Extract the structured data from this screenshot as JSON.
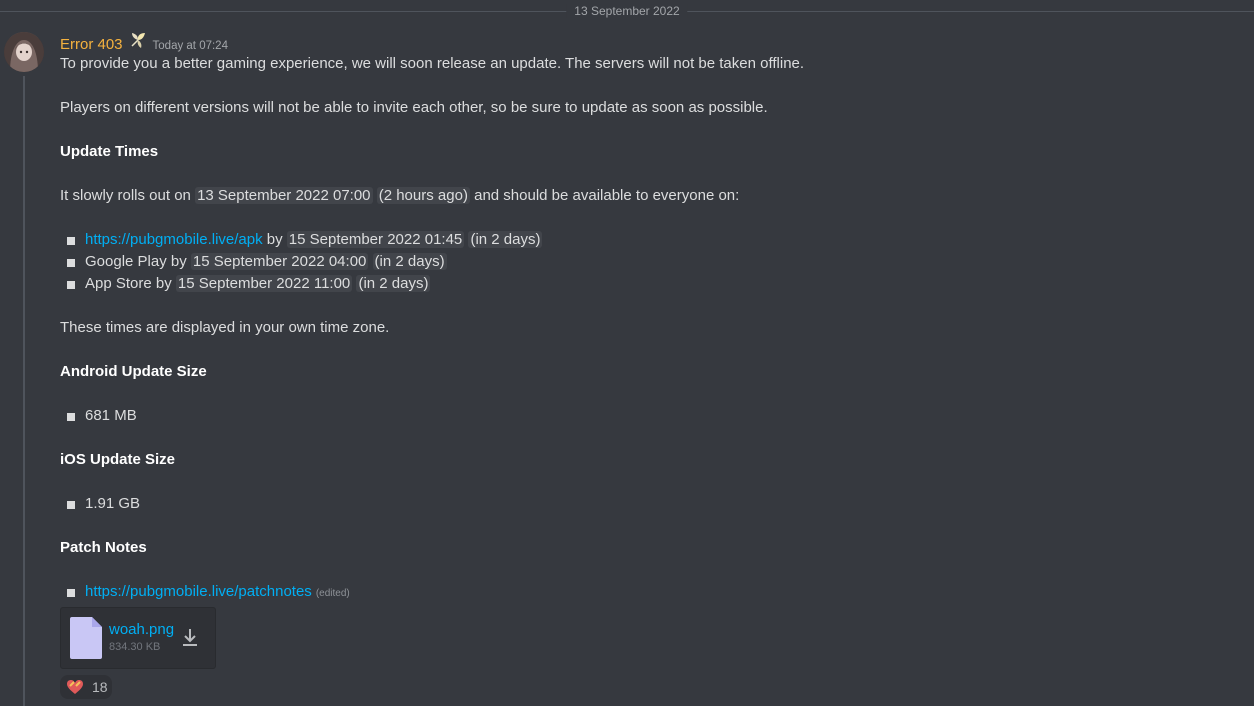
{
  "date_divider": "13 September 2022",
  "message": {
    "author": "Error 403",
    "author_color": "#f5b23f",
    "author_badge_icon": "sparkle-leaf-icon",
    "timestamp": "Today at 07:24",
    "avatar_icon": "user-avatar",
    "lines": {
      "p1": "To provide you a better gaming experience, we will soon release an update. The servers will not be taken offline.",
      "p2": "Players on different versions will not be able to invite each other, so be sure to update as soon as possible.",
      "h_update_times": "Update Times",
      "rollout_pre": "It slowly rolls out on ",
      "rollout_time": "13 September 2022 07:00",
      "rollout_relative": "2 hours ago",
      "rollout_post": " and should be available to everyone on:",
      "timezone_note": "These times are displayed in your own time zone.",
      "h_android": "Android Update Size",
      "android_size": "681 MB",
      "h_ios": "iOS Update Size",
      "ios_size": "1.91 GB",
      "h_patch": "Patch Notes",
      "patch_link": "https://pubgmobile.live/patchnotes",
      "edited": "(edited)"
    },
    "availability": [
      {
        "label": "https://pubgmobile.live/apk",
        "is_link": true,
        "by": " by ",
        "time": "15 September 2022 01:45",
        "relative": "in 2 days"
      },
      {
        "label": "Google Play",
        "is_link": false,
        "by": " by ",
        "time": "15 September 2022 04:00",
        "relative": "in 2 days"
      },
      {
        "label": "App Store",
        "is_link": false,
        "by": " by ",
        "time": "15 September 2022 11:00",
        "relative": "in 2 days"
      }
    ],
    "attachment": {
      "name": "woah.png",
      "size": "834.30 KB",
      "file_icon": "file-icon",
      "download_icon": "download-icon"
    },
    "reaction": {
      "emoji_icon": "heart-emoji-icon",
      "count": "18"
    }
  },
  "colors": {
    "background": "#36393f",
    "link": "#00aff4",
    "text": "#dcddde"
  }
}
